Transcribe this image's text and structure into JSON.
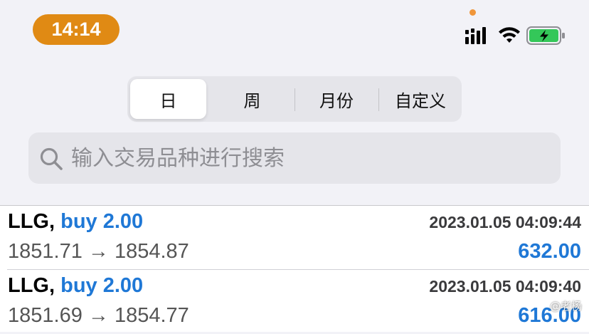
{
  "status_bar": {
    "time": "14:14"
  },
  "period_tabs": [
    {
      "label": "日",
      "active": true
    },
    {
      "label": "周",
      "active": false
    },
    {
      "label": "月份",
      "active": false
    },
    {
      "label": "自定义",
      "active": false
    }
  ],
  "search": {
    "placeholder": "输入交易品种进行搜索",
    "value": ""
  },
  "trades": [
    {
      "symbol": "LLG,",
      "trade": "buy 2.00",
      "timestamp": "2023.01.05 04:09:44",
      "prices": "1851.71 → 1854.87",
      "profit": "632.00"
    },
    {
      "symbol": "LLG,",
      "trade": "buy 2.00",
      "timestamp": "2023.01.05 04:09:40",
      "prices": "1851.69 → 1854.77",
      "profit": "616.00"
    }
  ],
  "watermark": "@老杨",
  "colors": {
    "time_pill": "#e08a14",
    "accent_blue": "#1f78d6",
    "battery_green": "#34c759"
  },
  "icons": {
    "signal": "cellular-signal-icon",
    "wifi": "wifi-icon",
    "battery": "battery-charging-icon",
    "search": "search-icon"
  }
}
